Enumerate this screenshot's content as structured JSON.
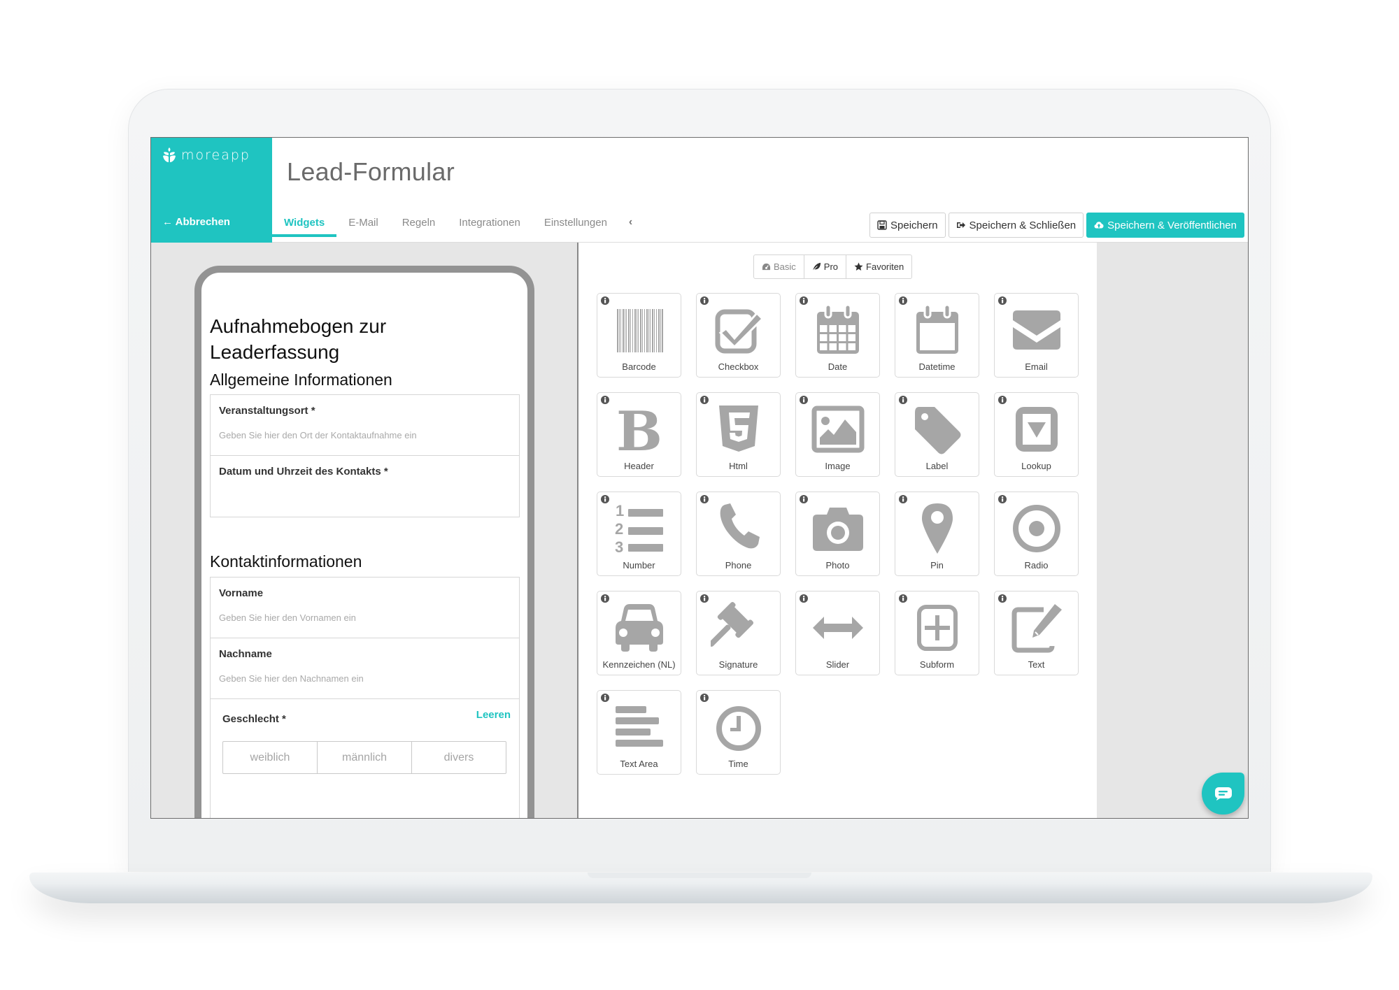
{
  "app": {
    "brand_name": "moreapp",
    "cancel_label": "Abbrechen",
    "form_title": "Lead-Formular",
    "accent_color": "#1fc4c1"
  },
  "tabs": [
    {
      "label": "Widgets",
      "active": true
    },
    {
      "label": "E-Mail",
      "active": false
    },
    {
      "label": "Regeln",
      "active": false
    },
    {
      "label": "Integrationen",
      "active": false
    },
    {
      "label": "Einstellungen",
      "active": false
    }
  ],
  "tab_collapse_icon": "chevron-left-icon",
  "actions": {
    "save_label": "Speichern",
    "save_close_label": "Speichern & Schließen",
    "save_publish_label": "Speichern & Veröffentlichen"
  },
  "preview": {
    "title": "Aufnahmebogen zur Leaderfassung",
    "sections": [
      {
        "heading": "Allgemeine Informationen",
        "fields": [
          {
            "label": "Veranstaltungsort *",
            "placeholder": "Geben Sie hier den Ort der Kontaktaufnahme ein"
          },
          {
            "label": "Datum und Uhrzeit des Kontakts *",
            "placeholder": ""
          }
        ]
      },
      {
        "heading": "Kontaktinformationen",
        "fields": [
          {
            "label": "Vorname",
            "placeholder": "Geben Sie hier den Vornamen ein"
          },
          {
            "label": "Nachname",
            "placeholder": "Geben Sie hier den Nachnamen ein"
          }
        ],
        "radio_field": {
          "label": "Geschlecht *",
          "clear_label": "Leeren",
          "options": [
            "weiblich",
            "männlich",
            "divers"
          ]
        }
      }
    ]
  },
  "widget_filters": [
    {
      "label": "Basic",
      "icon": "dashboard-icon",
      "active": false
    },
    {
      "label": "Pro",
      "icon": "leaf-icon",
      "active": true
    },
    {
      "label": "Favoriten",
      "icon": "star-icon",
      "active": true
    }
  ],
  "widgets": [
    {
      "label": "Barcode",
      "icon": "barcode-icon"
    },
    {
      "label": "Checkbox",
      "icon": "checkbox-icon"
    },
    {
      "label": "Date",
      "icon": "calendar-icon"
    },
    {
      "label": "Datetime",
      "icon": "calendar-empty-icon"
    },
    {
      "label": "Email",
      "icon": "envelope-icon"
    },
    {
      "label": "Header",
      "icon": "bold-icon"
    },
    {
      "label": "Html",
      "icon": "html5-icon"
    },
    {
      "label": "Image",
      "icon": "image-icon"
    },
    {
      "label": "Label",
      "icon": "tag-icon"
    },
    {
      "label": "Lookup",
      "icon": "dropdown-icon"
    },
    {
      "label": "Number",
      "icon": "ordered-list-icon"
    },
    {
      "label": "Phone",
      "icon": "phone-icon"
    },
    {
      "label": "Photo",
      "icon": "camera-icon"
    },
    {
      "label": "Pin",
      "icon": "map-pin-icon"
    },
    {
      "label": "Radio",
      "icon": "radio-icon"
    },
    {
      "label": "Kennzeichen (NL)",
      "icon": "car-icon"
    },
    {
      "label": "Signature",
      "icon": "gavel-icon"
    },
    {
      "label": "Slider",
      "icon": "arrows-horizontal-icon"
    },
    {
      "label": "Subform",
      "icon": "plus-square-icon"
    },
    {
      "label": "Text",
      "icon": "edit-icon"
    },
    {
      "label": "Text Area",
      "icon": "align-left-icon"
    },
    {
      "label": "Time",
      "icon": "clock-icon"
    }
  ],
  "chat_icon": "chat-icon"
}
